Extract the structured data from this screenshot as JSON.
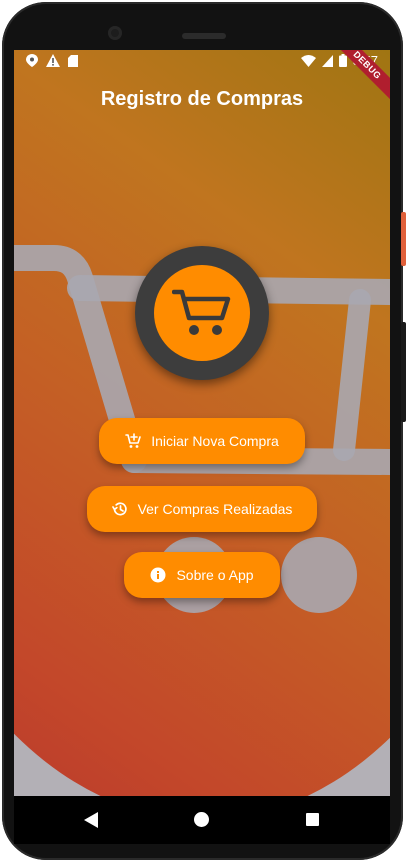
{
  "status_bar": {
    "time": "8:57",
    "left_icons": [
      "location-icon",
      "warning-icon",
      "sd-card-icon"
    ],
    "right_icons": [
      "wifi-icon",
      "signal-icon",
      "battery-icon"
    ],
    "debug_label": "DEBUG"
  },
  "header": {
    "title": "Registro de Compras"
  },
  "logo": {
    "icon": "shopping-cart-icon"
  },
  "buttons": {
    "start_purchase": {
      "label": "Iniciar Nova Compra",
      "icon": "add-shopping-cart-icon"
    },
    "view_purchases": {
      "label": "Ver Compras Realizadas",
      "icon": "history-icon"
    },
    "about": {
      "label": "Sobre o App",
      "icon": "info-icon"
    }
  },
  "nav": {
    "items": [
      "back-icon",
      "home-icon",
      "recent-apps-icon"
    ]
  },
  "colors": {
    "accent": "#ff8c00",
    "logo_ring": "#3d3d3d",
    "debug_ribbon": "#b01e2e"
  }
}
